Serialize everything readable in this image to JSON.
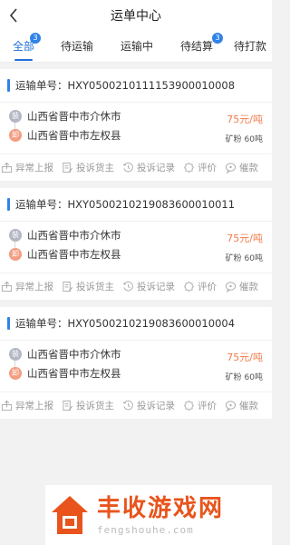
{
  "header": {
    "title": "运单中心"
  },
  "tabs": [
    {
      "label": "全部",
      "badge": "3",
      "active": true
    },
    {
      "label": "待运输",
      "badge": "",
      "active": false
    },
    {
      "label": "运输中",
      "badge": "",
      "active": false
    },
    {
      "label": "待结算",
      "badge": "3",
      "active": false
    },
    {
      "label": "待打款",
      "badge": "",
      "active": false
    }
  ],
  "waybill_prefix": "运输单号：",
  "load_tag": "装",
  "unload_tag": "卸",
  "waybills": [
    {
      "no": "HXY0500210111153900010008",
      "from": "山西省晋中市介休市",
      "to": "山西省晋中市左权县",
      "price": "75元/吨",
      "cargo": "矿粉 60吨"
    },
    {
      "no": "HXY0500210219083600010011",
      "from": "山西省晋中市介休市",
      "to": "山西省晋中市左权县",
      "price": "75元/吨",
      "cargo": "矿粉 60吨"
    },
    {
      "no": "HXY0500210219083600010004",
      "from": "山西省晋中市介休市",
      "to": "山西省晋中市左权县",
      "price": "75元/吨",
      "cargo": "矿粉 60吨"
    }
  ],
  "actions": [
    {
      "label": "异常上报",
      "icon": "report-upload-icon"
    },
    {
      "label": "投诉货主",
      "icon": "complaint-document-icon"
    },
    {
      "label": "投诉记录",
      "icon": "history-clock-icon"
    },
    {
      "label": "评价",
      "icon": "rating-badge-icon"
    },
    {
      "label": "催款",
      "icon": "payment-chat-icon"
    }
  ],
  "watermark": {
    "title": "丰收游戏网",
    "domain": "fengshouhe.com"
  },
  "colors": {
    "accent": "#1f6fd8",
    "badge": "#2f82e8",
    "price": "#f07c4d",
    "load_dot": "#b2b8c4",
    "unload_dot": "#f39d82",
    "brand": "#e8541c"
  }
}
